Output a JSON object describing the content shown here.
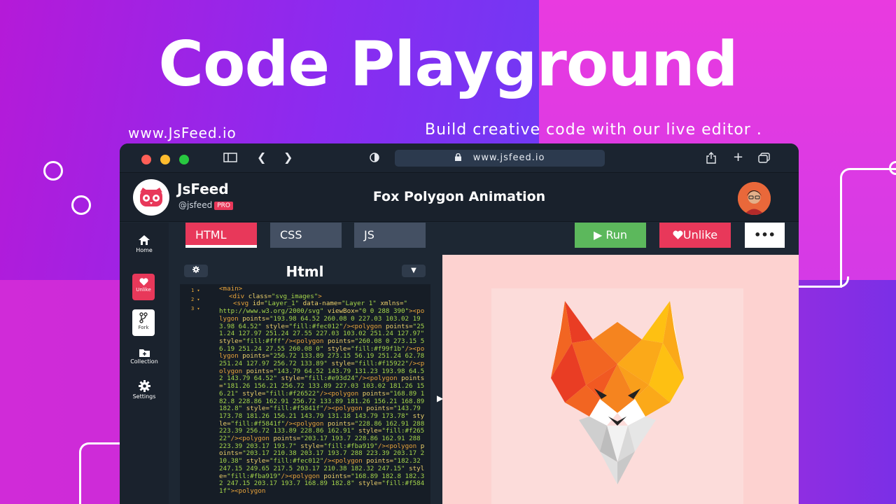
{
  "hero": {
    "title": "Code Playground",
    "site_url": "www.JsFeed.io",
    "tagline": "Build creative code with our live editor ."
  },
  "browser": {
    "url": "www.jsfeed.io",
    "lock_icon": "lock-icon",
    "traffic_lights": [
      "#ff5f57",
      "#febc2e",
      "#28c840"
    ]
  },
  "app": {
    "brand": "JsFeed",
    "handle": "@jsfeed",
    "badge": "PRO",
    "project_title": "Fox Polygon Animation"
  },
  "sidebar": {
    "items": [
      {
        "label": "Home",
        "icon": "home-icon"
      },
      {
        "label": "Unlike",
        "icon": "heart-icon"
      },
      {
        "label": "Fork",
        "icon": "fork-icon"
      },
      {
        "label": "Collection",
        "icon": "folder-icon"
      },
      {
        "label": "Settings",
        "icon": "gear-icon"
      }
    ]
  },
  "toolbar": {
    "tabs": [
      "HTML",
      "CSS",
      "JS"
    ],
    "active_tab": "HTML",
    "run_label": "Run",
    "unlike_label": "Unlike",
    "more_label": "•••",
    "colors": {
      "run": "#5cb85c",
      "unlike": "#e8385a",
      "active_tab": "#e8385a",
      "tab": "#445063"
    }
  },
  "editor": {
    "title": "Html",
    "line_numbers": [
      "1",
      "2",
      "3"
    ]
  }
}
